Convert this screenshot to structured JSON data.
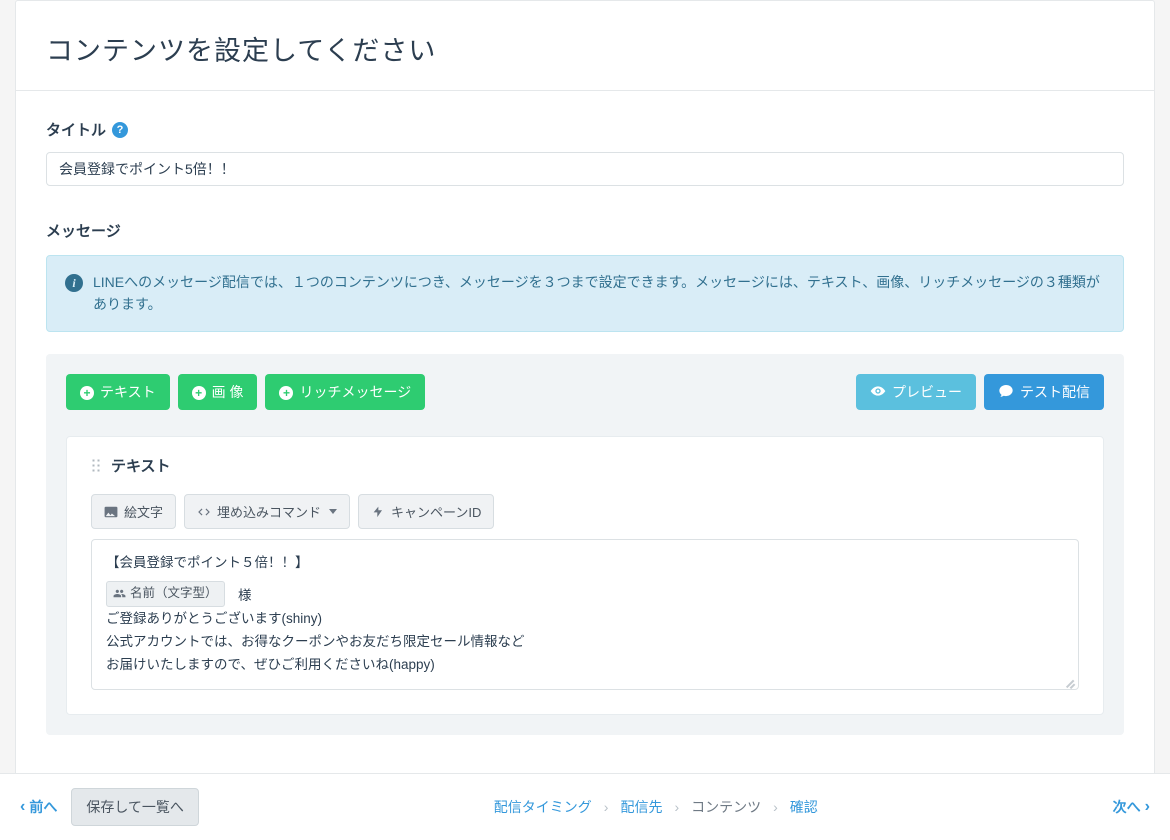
{
  "page": {
    "title": "コンテンツを設定してください"
  },
  "title_field": {
    "label": "タイトル",
    "value": "会員登録でポイント5倍！！"
  },
  "message_section": {
    "label": "メッセージ",
    "info": "LINEへのメッセージ配信では、１つのコンテンツにつき、メッセージを３つまで設定できます。メッセージには、テキスト、画像、リッチメッセージの３種類があります。"
  },
  "add_buttons": {
    "text": "テキスト",
    "image": "画 像",
    "rich": "リッチメッセージ",
    "preview": "プレビュー",
    "test_send": "テスト配信"
  },
  "text_card": {
    "header": "テキスト",
    "tools": {
      "emoji": "絵文字",
      "embed": "埋め込みコマンド",
      "campaign": "キャンペーンID"
    },
    "content": {
      "line1": "【会員登録でポイント５倍！！】",
      "tag_label": "名前（文字型）",
      "after_tag": "　様",
      "line3": "ご登録ありがとうございます(shiny)",
      "line4": "公式アカウントでは、お得なクーポンやお友だち限定セール情報など",
      "line5": "お届けいたしますので、ぜひご利用くださいね(happy)"
    }
  },
  "footer": {
    "prev": "前へ",
    "save_list": "保存して一覧へ",
    "crumbs": {
      "timing": "配信タイミング",
      "target": "配信先",
      "content": "コンテンツ",
      "confirm": "確認"
    },
    "next": "次へ"
  }
}
